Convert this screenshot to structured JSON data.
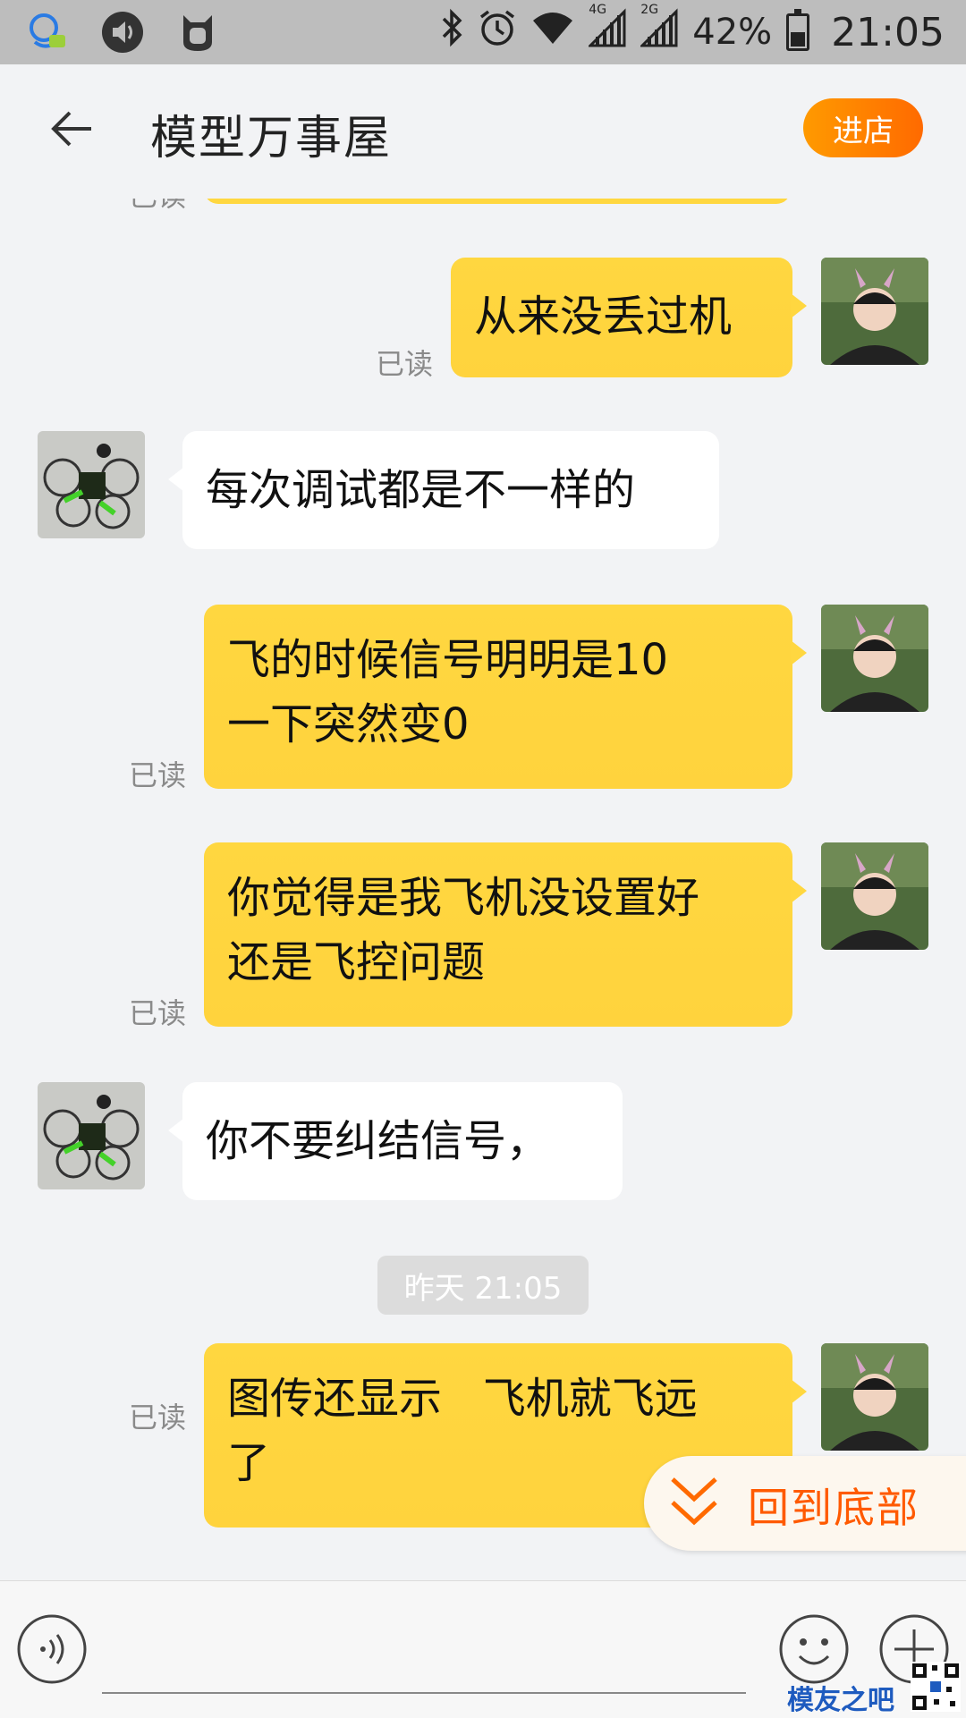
{
  "status_bar": {
    "network_1": "4G",
    "network_2": "2G",
    "battery": "42%",
    "time": "21:05"
  },
  "header": {
    "title": "模型万事屋",
    "enter_store": "进店"
  },
  "messages": [
    {
      "from": "me",
      "lines": [
        "从来没丢过机"
      ],
      "read": "已读"
    },
    {
      "from": "them",
      "lines": [
        "每次调试都是不一样的"
      ]
    },
    {
      "from": "me",
      "lines": [
        "飞的时候信号明明是10",
        "一下突然变0"
      ],
      "read": "已读"
    },
    {
      "from": "me",
      "lines": [
        "你觉得是我飞机没设置好",
        "还是飞控问题"
      ],
      "read": "已读"
    },
    {
      "from": "them",
      "lines": [
        "你不要纠结信号，"
      ]
    },
    {
      "from": "me",
      "lines": [
        "图传还显示   飞机就飞远",
        "了"
      ],
      "read": "已读"
    }
  ],
  "partial_top_read": "已读",
  "timestamp": "昨天 21:05",
  "back_to_bottom": "回到底部",
  "watermark": {
    "text": "模友之吧"
  },
  "colors": {
    "my_bubble": "#ffd740",
    "their_bubble": "#ffffff",
    "accent_orange": "#ff6a00",
    "background": "#f2f3f5"
  },
  "icons": [
    "voice-icon",
    "emoji-icon",
    "plus-icon",
    "back-arrow-icon",
    "chevron-double-down-icon"
  ]
}
